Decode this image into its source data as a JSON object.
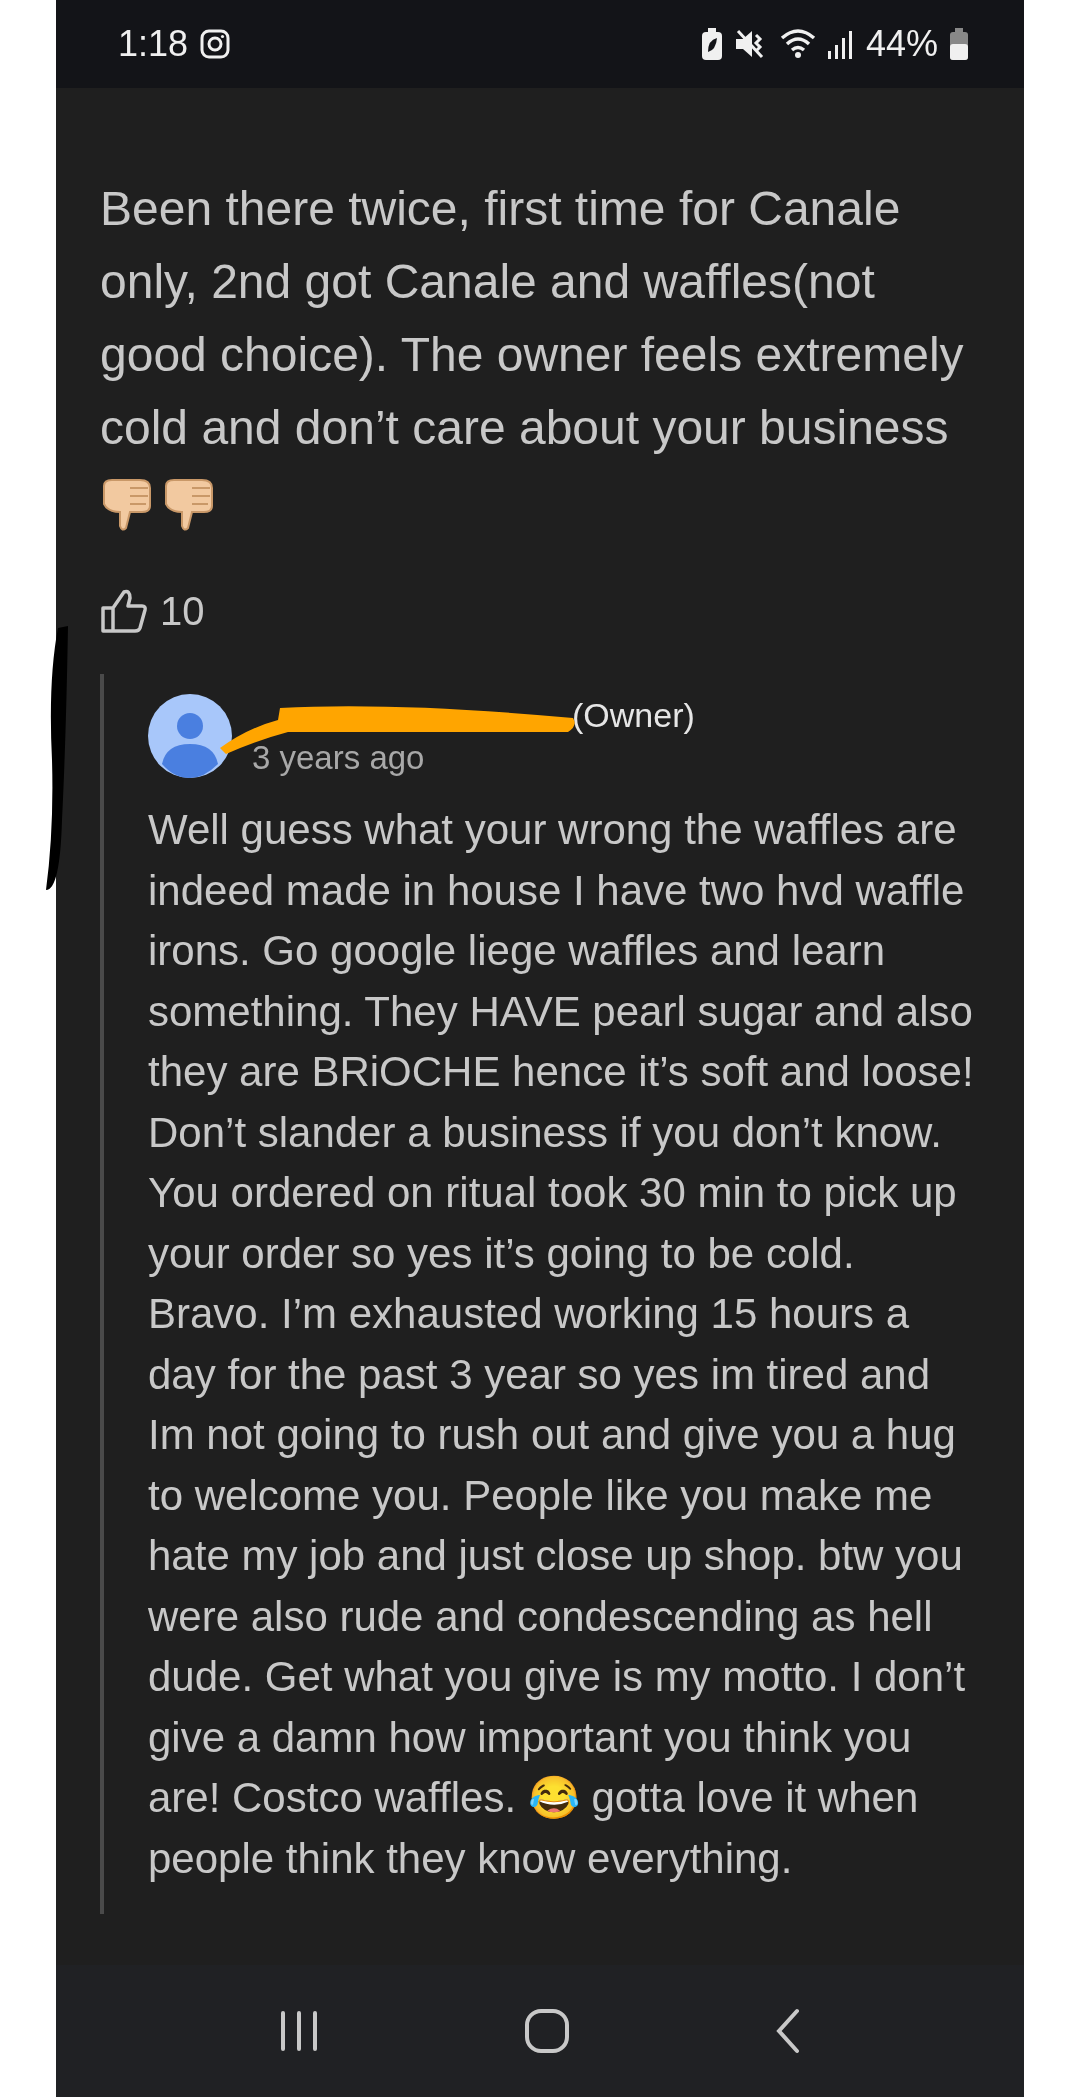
{
  "status_bar": {
    "time": "1:18",
    "battery": "44%"
  },
  "review": {
    "text": "Been there twice, first time for Canale only, 2nd got Canale and waffles(not good choice). The owner feels extremely cold and don’t care about your business",
    "likes": "10"
  },
  "reply": {
    "author_suffix": "(Owner)",
    "time": "3 years ago",
    "text": "Well guess what your wrong the waffles are indeed made in house I have two hvd waffle irons. Go google liege waffles and learn something. They HAVE pearl sugar and also they are BRiOCHE hence it’s soft and loose! Don’t slander a business if you don’t know. You ordered on ritual took 30 min to pick up your order so yes it’s going to be cold. Bravo. I’m exhausted working 15 hours a day for the past 3 year so yes im tired and Im not going to rush out and give you a hug to welcome you. People like you make me hate my job and just close up shop. btw you were also rude and condescending as hell dude. Get what you give is my motto. I don’t give a damn how important you think you are! Costco waffles. 😂 gotta love it when people think they know everything."
  }
}
